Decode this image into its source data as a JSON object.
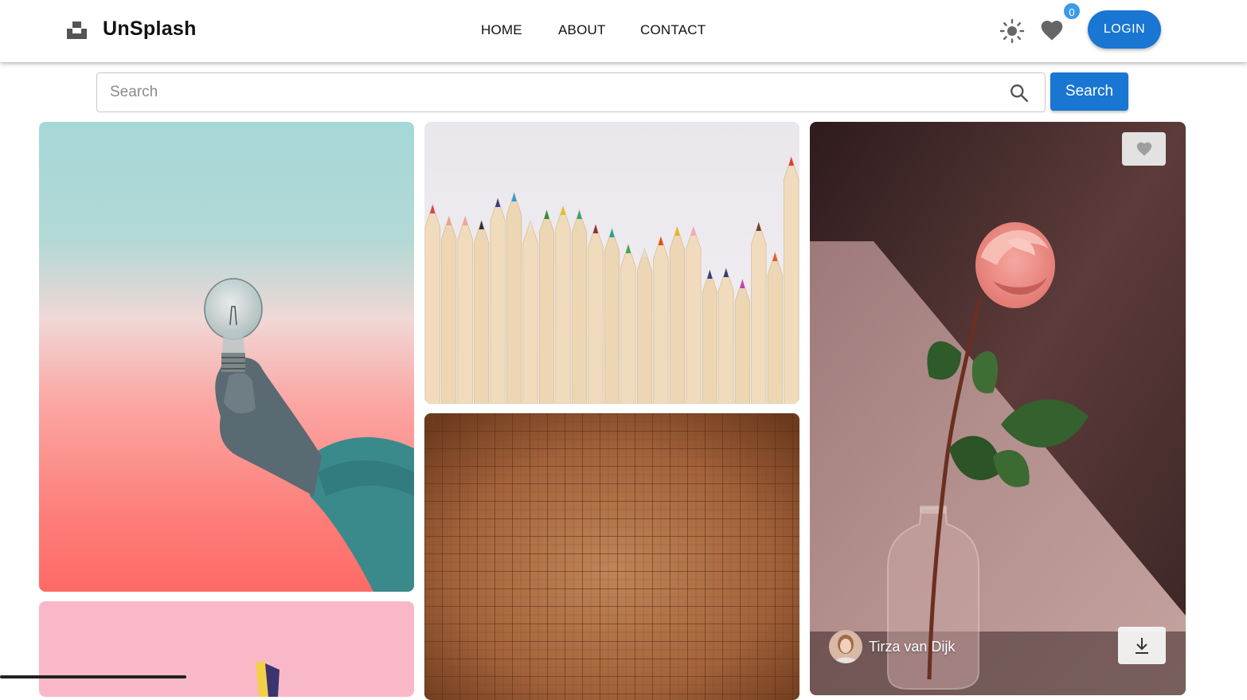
{
  "header": {
    "brand": "UnSplash",
    "logo_icon": "unsplash-logo-icon",
    "nav": [
      {
        "label": "HOME"
      },
      {
        "label": "ABOUT"
      },
      {
        "label": "CONTACT"
      }
    ],
    "theme_icon": "sun-icon",
    "favorites_icon": "heart-icon",
    "favorites_count": "0",
    "login_label": "LOGIN"
  },
  "search": {
    "placeholder": "Search",
    "value": "",
    "button_label": "Search",
    "icon": "search-icon"
  },
  "photos": [
    {
      "subject": "hand holding light bulb"
    },
    {
      "subject": "pink background"
    },
    {
      "subject": "colored pencils"
    },
    {
      "subject": "brown grid texture"
    },
    {
      "subject": "pink rose in glass vase",
      "author": "Tirza van Dijk",
      "actions": [
        "heart-icon",
        "download-icon"
      ]
    }
  ],
  "colors": {
    "accent": "#1976d2",
    "badge": "#3d9ae8"
  }
}
